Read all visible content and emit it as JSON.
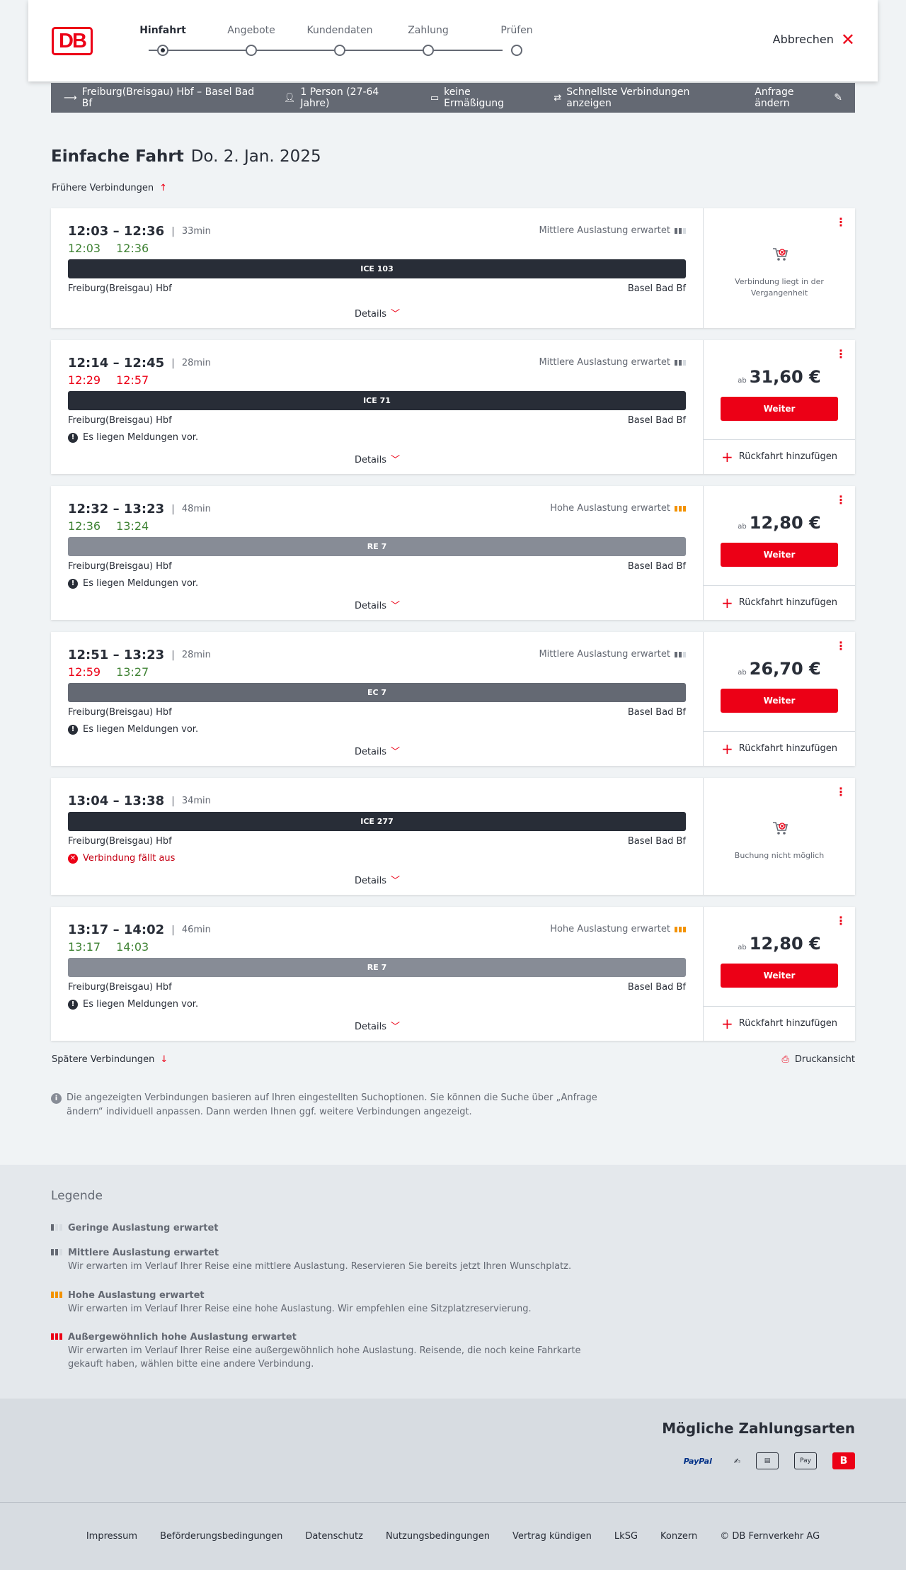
{
  "header": {
    "logo": "DB",
    "steps": [
      {
        "label": "Hinfahrt",
        "active": true
      },
      {
        "label": "Angebote",
        "active": false
      },
      {
        "label": "Kundendaten",
        "active": false
      },
      {
        "label": "Zahlung",
        "active": false
      },
      {
        "label": "Prüfen",
        "active": false
      }
    ],
    "cancel_label": "Abbrechen"
  },
  "summary": {
    "route": "Freiburg(Breisgau) Hbf – Basel Bad Bf",
    "persons": "1 Person (27-64 Jahre)",
    "discount": "keine Ermäßigung",
    "fastest": "Schnellste Verbindungen anzeigen",
    "edit": "Anfrage ändern"
  },
  "title": {
    "type": "Einfache Fahrt",
    "date": "Do. 2. Jan. 2025"
  },
  "earlier": "Frühere Verbindungen",
  "later": "Spätere Verbindungen",
  "print": "Druckansicht",
  "connections": [
    {
      "times": "12:03 – 12:36",
      "duration": "33min",
      "rt_dep": "12:03",
      "rt_arr": "12:36",
      "rt_dep_color": "green",
      "rt_arr_color": "green",
      "load": "Mittlere Auslastung erwartet",
      "train": "ICE 103",
      "from": "Freiburg(Breisgau) Hbf",
      "to": "Basel Bad Bf",
      "message": "",
      "details": "Details",
      "notice": "Verbindung liegt in der Vergangenheit"
    },
    {
      "times": "12:14 – 12:45",
      "duration": "28min",
      "rt_dep": "12:29",
      "rt_arr": "12:57",
      "load": "Mittlere Auslastung erwartet",
      "train": "ICE 71",
      "from": "Freiburg(Breisgau) Hbf",
      "to": "Basel Bad Bf",
      "message": "Es liegen Meldungen vor.",
      "details": "Details",
      "price_prefix": "ab",
      "price": "31,60 €",
      "button": "Weiter",
      "return": "Rückfahrt hinzufügen"
    },
    {
      "times": "12:32 – 13:23",
      "duration": "48min",
      "rt_dep": "12:36",
      "rt_arr": "13:24",
      "load": "Hohe Auslastung erwartet",
      "train": "RE 7",
      "from": "Freiburg(Breisgau) Hbf",
      "to": "Basel Bad Bf",
      "message": "Es liegen Meldungen vor.",
      "details": "Details",
      "price_prefix": "ab",
      "price": "12,80 €",
      "button": "Weiter",
      "return": "Rückfahrt hinzufügen"
    },
    {
      "times": "12:51 – 13:23",
      "duration": "28min",
      "rt_dep": "12:59",
      "rt_arr": "13:27",
      "load": "Mittlere Auslastung erwartet",
      "train": "EC 7",
      "from": "Freiburg(Breisgau) Hbf",
      "to": "Basel Bad Bf",
      "message": "Es liegen Meldungen vor.",
      "details": "Details",
      "price_prefix": "ab",
      "price": "26,70 €",
      "button": "Weiter",
      "return": "Rückfahrt hinzufügen"
    },
    {
      "times": "13:04 – 13:38",
      "duration": "34min",
      "train": "ICE 277",
      "from": "Freiburg(Breisgau) Hbf",
      "to": "Basel Bad Bf",
      "message": "Verbindung fällt aus",
      "details": "Details",
      "notice": "Buchung nicht möglich"
    },
    {
      "times": "13:17 – 14:02",
      "duration": "46min",
      "rt_dep": "13:17",
      "rt_arr": "14:03",
      "load": "Hohe Auslastung erwartet",
      "train": "RE 7",
      "from": "Freiburg(Breisgau) Hbf",
      "to": "Basel Bad Bf",
      "message": "Es liegen Meldungen vor.",
      "details": "Details",
      "price_prefix": "ab",
      "price": "12,80 €",
      "button": "Weiter",
      "return": "Rückfahrt hinzufügen"
    }
  ],
  "info": "Die angezeigten Verbindungen basieren auf Ihren eingestellten Suchoptionen. Sie können die Suche über „Anfrage ändern“ individuell anpassen. Dann werden Ihnen ggf. weitere Verbindungen angezeigt.",
  "legend": {
    "title": "Legende",
    "items": [
      {
        "name": "Geringe Auslastung erwartet",
        "desc": ""
      },
      {
        "name": "Mittlere Auslastung erwartet",
        "desc": "Wir erwarten im Verlauf Ihrer Reise eine mittlere Auslastung. Reservieren Sie bereits jetzt Ihren Wunschplatz."
      },
      {
        "name": "Hohe Auslastung erwartet",
        "desc": "Wir erwarten im Verlauf Ihrer Reise eine hohe Auslastung. Wir empfehlen eine Sitzplatzreservierung."
      },
      {
        "name": "Außergewöhnlich hohe Auslastung erwartet",
        "desc": "Wir erwarten im Verlauf Ihrer Reise eine außergewöhnlich hohe Auslastung. Reisende, die noch keine Fahrkarte gekauft haben, wählen bitte eine andere Verbindung."
      }
    ]
  },
  "payment": {
    "title": "Mögliche Zahlungsarten",
    "methods": [
      "PayPal",
      "Pay"
    ]
  },
  "footer": [
    "Impressum",
    "Beförderungsbedingungen",
    "Datenschutz",
    "Nutzungsbedingungen",
    "Vertrag kündigen",
    "LkSG",
    "Konzern",
    "© DB Fernverkehr AG"
  ],
  "colors": {
    "accent": "#ec0016",
    "on_time": "#408335",
    "delay": "#ec0016",
    "high_load": "#f39200"
  }
}
